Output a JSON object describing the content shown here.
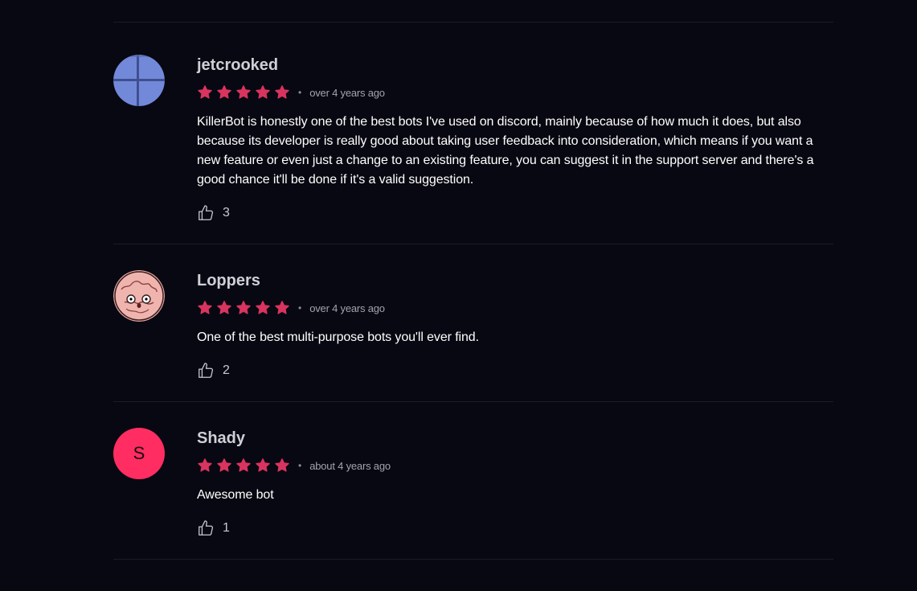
{
  "colors": {
    "background": "#080812",
    "star": "#d8345f",
    "divider": "#1b1b28",
    "avatar_letter_bg": "#ff2d61"
  },
  "reviews": [
    {
      "username": "jetcrooked",
      "rating": 5,
      "max_rating": 5,
      "time": "over 4 years ago",
      "text": "KillerBot is honestly one of the best bots I've used on discord, mainly because of how much it does, but also because its developer is really good about taking user feedback into consideration, which means if you want a new feature or even just a change to an existing feature, you can suggest it in the support server and there's a good chance it'll be done if it's a valid suggestion.",
      "likes": "3",
      "avatar_icon": "windows-logo-icon"
    },
    {
      "username": "Loppers",
      "rating": 5,
      "max_rating": 5,
      "time": "over 4 years ago",
      "text": "One of the best multi-purpose bots you'll ever find.",
      "likes": "2",
      "avatar_icon": "brain-creature-icon"
    },
    {
      "username": "Shady",
      "rating": 5,
      "max_rating": 5,
      "time": "about 4 years ago",
      "text": "Awesome bot",
      "likes": "1",
      "avatar_letter": "S"
    }
  ]
}
